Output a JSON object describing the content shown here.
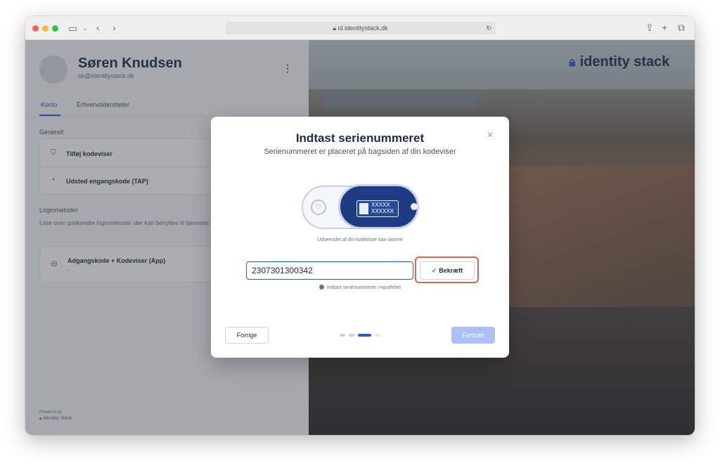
{
  "browser": {
    "url": "id.identitystack.dk"
  },
  "profile": {
    "name": "Søren Knudsen",
    "email": "sk@identitystack.dk"
  },
  "tabs": [
    {
      "label": "Konto"
    },
    {
      "label": "Erhvervsidentiteter"
    }
  ],
  "general": {
    "heading": "Generelt",
    "items": [
      {
        "label": "Tilføj kodeviser"
      },
      {
        "label": "Udsted engangskode (TAP)"
      }
    ]
  },
  "login_methods": {
    "heading": "Loginmetoder",
    "description": "Liste over godkendte loginmetoder, der kan benyttes til tjenester.",
    "items": [
      {
        "label": "Adgangskode + Kodeviser (App)",
        "sub": "-"
      }
    ]
  },
  "footer": {
    "powered_by": "Powered by",
    "brand": "identity stack"
  },
  "brand_logo": "identity stack",
  "modal": {
    "title": "Indtast serienummeret",
    "subtitle": "Serienummeret er placeret på bagsiden af din kodeviser",
    "device_text_1": "XXXXX",
    "device_text_2": "XXXXXX",
    "device_caption": "Udseendet af din kodeviser kan variere",
    "input_value": "2307301300342",
    "confirm_label": "Bekræft",
    "hint": "Indtast serienummeret i inputfeltet",
    "prev_label": "Forrige",
    "next_label": "Fortsæt",
    "steps_total": 4,
    "current_step": 3
  },
  "colors": {
    "accent": "#2f55d4",
    "highlight": "#d9664a",
    "success": "#16a34a"
  }
}
